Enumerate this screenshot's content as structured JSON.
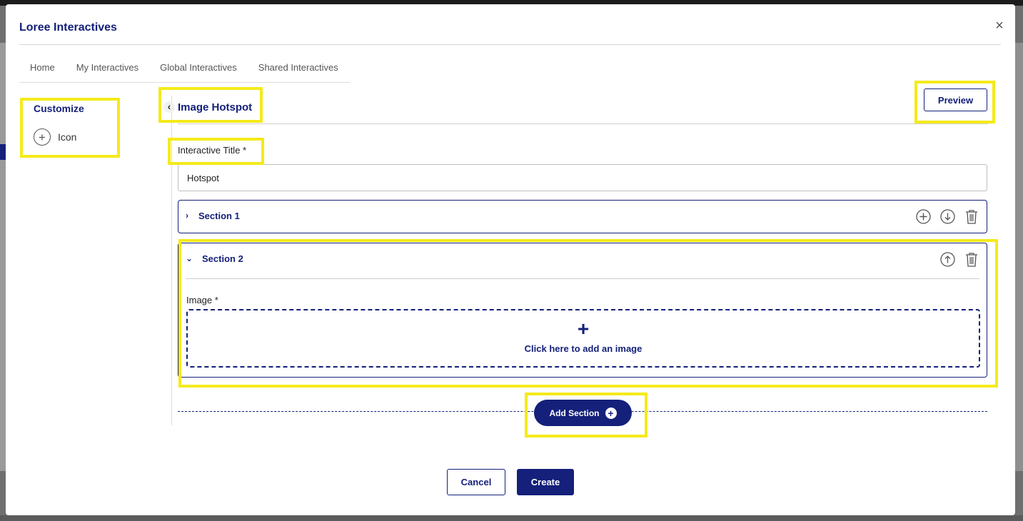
{
  "modal": {
    "title": "Loree Interactives",
    "close_label": "×"
  },
  "tabs": [
    {
      "label": "Home"
    },
    {
      "label": "My Interactives"
    },
    {
      "label": "Global Interactives"
    },
    {
      "label": "Shared Interactives"
    }
  ],
  "sidebar": {
    "title": "Customize",
    "icon_item": {
      "label": "Icon",
      "icon": "plus-circle-icon"
    }
  },
  "editor": {
    "title": "Image Hotspot",
    "back_icon": "chevron-left-icon",
    "preview_label": "Preview",
    "interactive_title_label": "Interactive Title *",
    "interactive_title_value": "Hotspot",
    "sections": [
      {
        "title": "Section 1",
        "expanded": false,
        "actions": [
          "add-section-icon",
          "move-down-icon",
          "delete-icon"
        ]
      },
      {
        "title": "Section 2",
        "expanded": true,
        "actions": [
          "move-up-icon",
          "delete-icon"
        ],
        "image_label": "Image *",
        "dropzone_plus": "+",
        "dropzone_text": "Click here to add an image"
      }
    ],
    "add_section_label": "Add Section"
  },
  "footer": {
    "cancel_label": "Cancel",
    "create_label": "Create"
  },
  "colors": {
    "brand": "#14207a",
    "highlight": "#f5ea1a"
  }
}
